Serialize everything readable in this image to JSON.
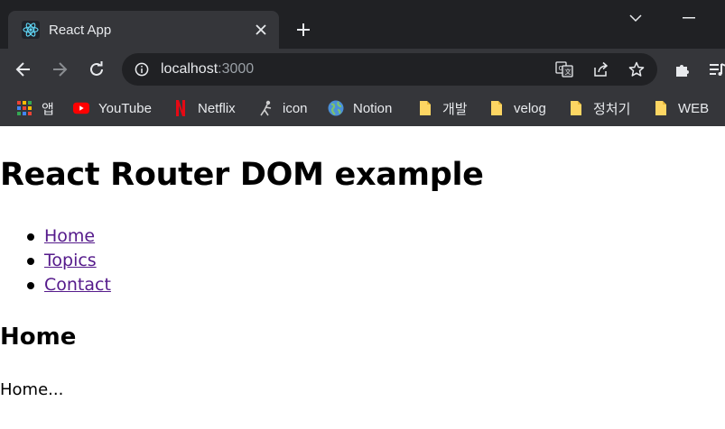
{
  "browser": {
    "tab": {
      "title": "React App",
      "favicon": "react-logo-icon"
    },
    "address_bar": {
      "host": "localhost",
      "port": ":3000"
    },
    "bookmarks": [
      {
        "label": "앱",
        "icon": "apps-grid-icon"
      },
      {
        "label": "YouTube",
        "icon": "youtube-icon"
      },
      {
        "label": "Netflix",
        "icon": "netflix-icon"
      },
      {
        "label": "icon",
        "icon": "figure-icon"
      },
      {
        "label": "Notion",
        "icon": "globe-icon"
      },
      {
        "label": "개발",
        "icon": "folder-icon"
      },
      {
        "label": "velog",
        "icon": "folder-icon"
      },
      {
        "label": "정처기",
        "icon": "folder-icon"
      },
      {
        "label": "WEB",
        "icon": "folder-icon"
      }
    ],
    "colors": {
      "frame": "#202124",
      "toolbar": "#35363a",
      "text": "#e8eaed",
      "folder": "#fdd663"
    }
  },
  "page": {
    "title": "React Router DOM example",
    "nav": [
      {
        "label": "Home"
      },
      {
        "label": "Topics"
      },
      {
        "label": "Contact"
      }
    ],
    "section_title": "Home",
    "section_body": "Home...",
    "link_color": "#551a8b"
  }
}
